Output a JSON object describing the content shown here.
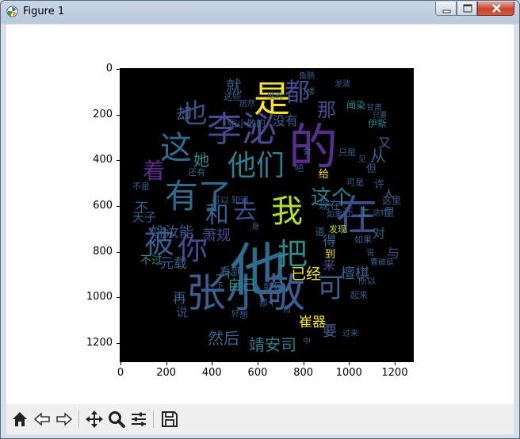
{
  "window": {
    "title": "Figure 1"
  },
  "controls": {
    "minimize": "minimize",
    "maximize": "maximize",
    "close": "close"
  },
  "axes": {
    "yticks": [
      "0",
      "200",
      "400",
      "600",
      "800",
      "1000",
      "1200"
    ],
    "xticks": [
      "0",
      "200",
      "400",
      "600",
      "800",
      "1000",
      "1200"
    ]
  },
  "wordcloud": {
    "words": [
      {
        "t": "的",
        "c": "#5a2d8c"
      },
      {
        "t": "他",
        "c": "#2f6b8e"
      },
      {
        "t": "张小敬",
        "c": "#3a5f8e"
      },
      {
        "t": "是",
        "c": "#f5e52a"
      },
      {
        "t": "李泌",
        "c": "#4a4890"
      },
      {
        "t": "有了",
        "c": "#2f6b8e"
      },
      {
        "t": "在",
        "c": "#3c4f8a"
      },
      {
        "t": "我",
        "c": "#b5dd2b"
      },
      {
        "t": "把",
        "c": "#2f8b8a"
      },
      {
        "t": "被",
        "c": "#3a5f8e"
      },
      {
        "t": "你",
        "c": "#4a4890"
      },
      {
        "t": "他们",
        "c": "#2f7d8e"
      },
      {
        "t": "这",
        "c": "#2f6b8e"
      },
      {
        "t": "也",
        "c": "#3c4f8a"
      },
      {
        "t": "都",
        "c": "#4a4890"
      },
      {
        "t": "和",
        "c": "#3a5f8e"
      },
      {
        "t": "去",
        "c": "#3c4f8a"
      },
      {
        "t": "这个",
        "c": "#2f7d8e"
      },
      {
        "t": "可",
        "c": "#3a5f8e"
      },
      {
        "t": "着",
        "c": "#5a2d8c"
      },
      {
        "t": "那",
        "c": "#4a4890"
      },
      {
        "t": "就",
        "c": "#3a5f8e"
      },
      {
        "t": "却",
        "c": "#3a5f8e"
      },
      {
        "t": "她",
        "c": "#2f8b8a"
      },
      {
        "t": "姚汝能",
        "c": "#3a5f8e"
      },
      {
        "t": "萧规",
        "c": "#4a4890"
      },
      {
        "t": "元载",
        "c": "#3a5f8e"
      },
      {
        "t": "靖安司",
        "c": "#2f7d8e"
      },
      {
        "t": "然后",
        "c": "#3a5f8e"
      },
      {
        "t": "已经",
        "c": "#f5e52a"
      },
      {
        "t": "檀棋",
        "c": "#3a5f8e"
      },
      {
        "t": "自己",
        "c": "#2f8b8a"
      },
      {
        "t": "崔器",
        "c": "#f5e52a"
      },
      {
        "t": "没有",
        "c": "#3a5f8e"
      },
      {
        "t": "从",
        "c": "#3a5f8e"
      },
      {
        "t": "来",
        "c": "#4a4890"
      },
      {
        "t": "得",
        "c": "#3a5f8e"
      },
      {
        "t": "对",
        "c": "#3a5f8e"
      },
      {
        "t": "与",
        "c": "#4a4890"
      },
      {
        "t": "上",
        "c": "#2f8b8a"
      },
      {
        "t": "又",
        "c": "#3a5f8e"
      },
      {
        "t": "里",
        "c": "#3a5f8e"
      },
      {
        "t": "人",
        "c": "#2f7d8e"
      },
      {
        "t": "要",
        "c": "#3a5f8e"
      },
      {
        "t": "再",
        "c": "#3a5f8e"
      },
      {
        "t": "说",
        "c": "#3c4f8a"
      },
      {
        "t": "不",
        "c": "#3a5f8e"
      },
      {
        "t": "天子",
        "c": "#3a5f8e"
      },
      {
        "t": "不过",
        "c": "#2f8b8a"
      },
      {
        "t": "看到",
        "c": "#3a5f8e"
      },
      {
        "t": "就是",
        "c": "#3a5f8e"
      },
      {
        "t": "到",
        "c": "#f5e52a"
      },
      {
        "t": "许",
        "c": "#3a5f8e"
      },
      {
        "t": "这里",
        "c": "#3a5f8e"
      },
      {
        "t": "道",
        "c": "#3a5f8e"
      },
      {
        "t": "但",
        "c": "#3a5f8e"
      },
      {
        "t": "现在",
        "c": "#3a5f8e"
      },
      {
        "t": "还",
        "c": "#4a4890"
      },
      {
        "t": "给",
        "c": "#f5e52a"
      },
      {
        "t": "闻染",
        "c": "#2f8b8a"
      },
      {
        "t": "伊斯",
        "c": "#2f7d8e"
      },
      {
        "t": "发现",
        "c": "#b5dd2b"
      },
      {
        "t": "这些",
        "c": "#3a5f8e"
      },
      {
        "t": "张小敬的",
        "c": "#3a5f8e"
      },
      {
        "t": "只是",
        "c": "#3a5f8e"
      },
      {
        "t": "可是",
        "c": "#3a5f8e"
      },
      {
        "t": "如果",
        "c": "#3a5f8e"
      },
      {
        "t": "不是",
        "c": "#3a5f8e"
      },
      {
        "t": "还有",
        "c": "#3a5f8e"
      },
      {
        "t": "可以",
        "c": "#3a5f8e"
      },
      {
        "t": "那个",
        "c": "#3a5f8e"
      },
      {
        "t": "一个",
        "c": "#2f8b8a"
      },
      {
        "t": "知道",
        "c": "#3a5f8e"
      },
      {
        "t": "所以",
        "c": "#3a5f8e"
      },
      {
        "t": "曹破延",
        "c": "#3a5f8e"
      },
      {
        "t": "龙波",
        "c": "#3a5f8e"
      },
      {
        "t": "这样",
        "c": "#3a5f8e"
      },
      {
        "t": "起来",
        "c": "#3a5f8e"
      },
      {
        "t": "会",
        "c": "#3a5f8e"
      },
      {
        "t": "吧",
        "c": "#3a5f8e"
      },
      {
        "t": "鱼肠",
        "c": "#3a5f8e"
      },
      {
        "t": "灯楼",
        "c": "#3a5f8e"
      },
      {
        "t": "居然",
        "c": "#3a5f8e"
      },
      {
        "t": "一下",
        "c": "#3a5f8e"
      },
      {
        "t": "甘肃",
        "c": "#3a5f8e"
      },
      {
        "t": "身",
        "c": "#3a5f8e"
      },
      {
        "t": "只要",
        "c": "#3a5f8e"
      },
      {
        "t": "如果",
        "c": "#3a5f8e"
      },
      {
        "t": "过来",
        "c": "#3a5f8e"
      },
      {
        "t": "他的",
        "c": "#3a5f8e"
      },
      {
        "t": "想",
        "c": "#3a5f8e"
      },
      {
        "t": "中",
        "c": "#3a5f8e"
      },
      {
        "t": "说",
        "c": "#3a5f8e"
      },
      {
        "t": "好",
        "c": "#3a5f8e"
      },
      {
        "t": "而",
        "c": "#3a5f8e"
      },
      {
        "t": "见",
        "c": "#3a5f8e"
      }
    ]
  }
}
